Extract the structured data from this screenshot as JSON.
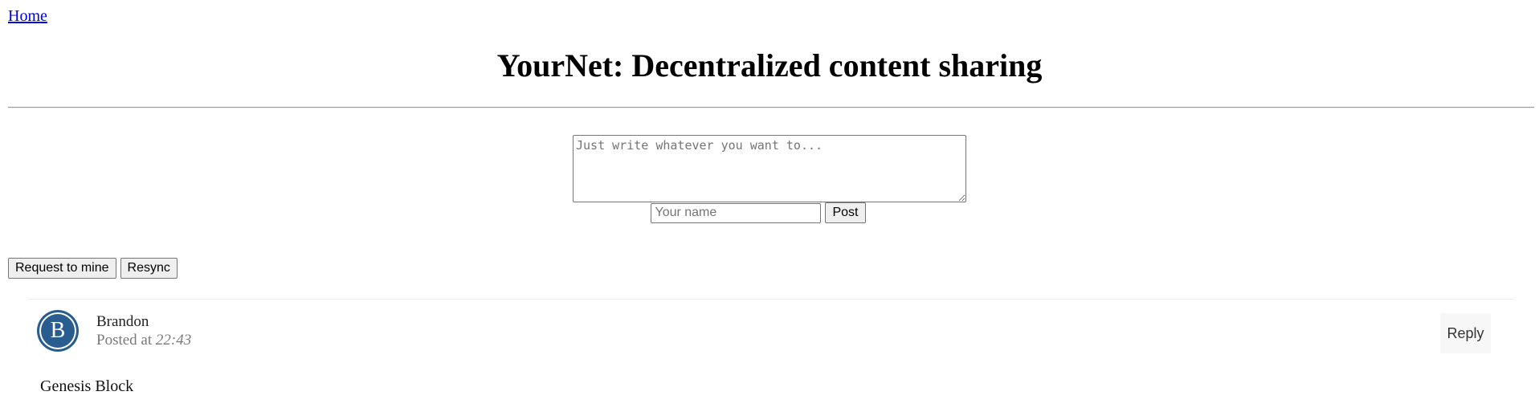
{
  "nav": {
    "home_label": "Home"
  },
  "header": {
    "title": "YourNet: Decentralized content sharing"
  },
  "composer": {
    "content_placeholder": "Just write whatever you want to...",
    "content_value": "",
    "name_placeholder": "Your name",
    "name_value": "",
    "post_label": "Post"
  },
  "actions": {
    "request_label": "Request to mine",
    "resync_label": "Resync"
  },
  "feed": {
    "posts": [
      {
        "avatar_letter": "B",
        "author": "Brandon",
        "posted_prefix": "Posted at",
        "time": "22:43",
        "reply_label": "Reply",
        "body": "Genesis Block"
      }
    ]
  },
  "colors": {
    "avatar_bg": "#2a5d8f",
    "link": "#0000ee",
    "muted_text": "#7a7a7a"
  }
}
